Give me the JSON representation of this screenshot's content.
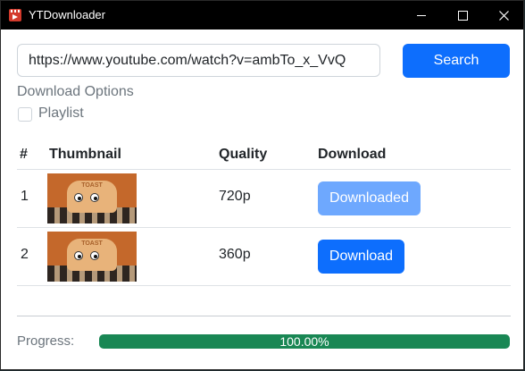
{
  "window": {
    "title": "YTDownloader",
    "controls": [
      "minimize-icon",
      "maximize-icon",
      "close-icon"
    ]
  },
  "search": {
    "url_value": "https://www.youtube.com/watch?v=ambTo_x_VvQ",
    "button_label": "Search"
  },
  "options": {
    "heading": "Download Options",
    "playlist_label": "Playlist",
    "playlist_checked": false
  },
  "table": {
    "headers": [
      "#",
      "Thumbnail",
      "Quality",
      "Download"
    ],
    "rows": [
      {
        "num": "1",
        "quality": "720p",
        "action": "Downloaded",
        "state": "downloaded"
      },
      {
        "num": "2",
        "quality": "360p",
        "action": "Download",
        "state": "available"
      }
    ]
  },
  "progress": {
    "label": "Progress:",
    "text": "100.00%",
    "value": 1.0
  },
  "colors": {
    "primary": "#0d6efd",
    "primary_disabled": "#6ea8fe",
    "success": "#198754",
    "titlebar": "#000000"
  }
}
